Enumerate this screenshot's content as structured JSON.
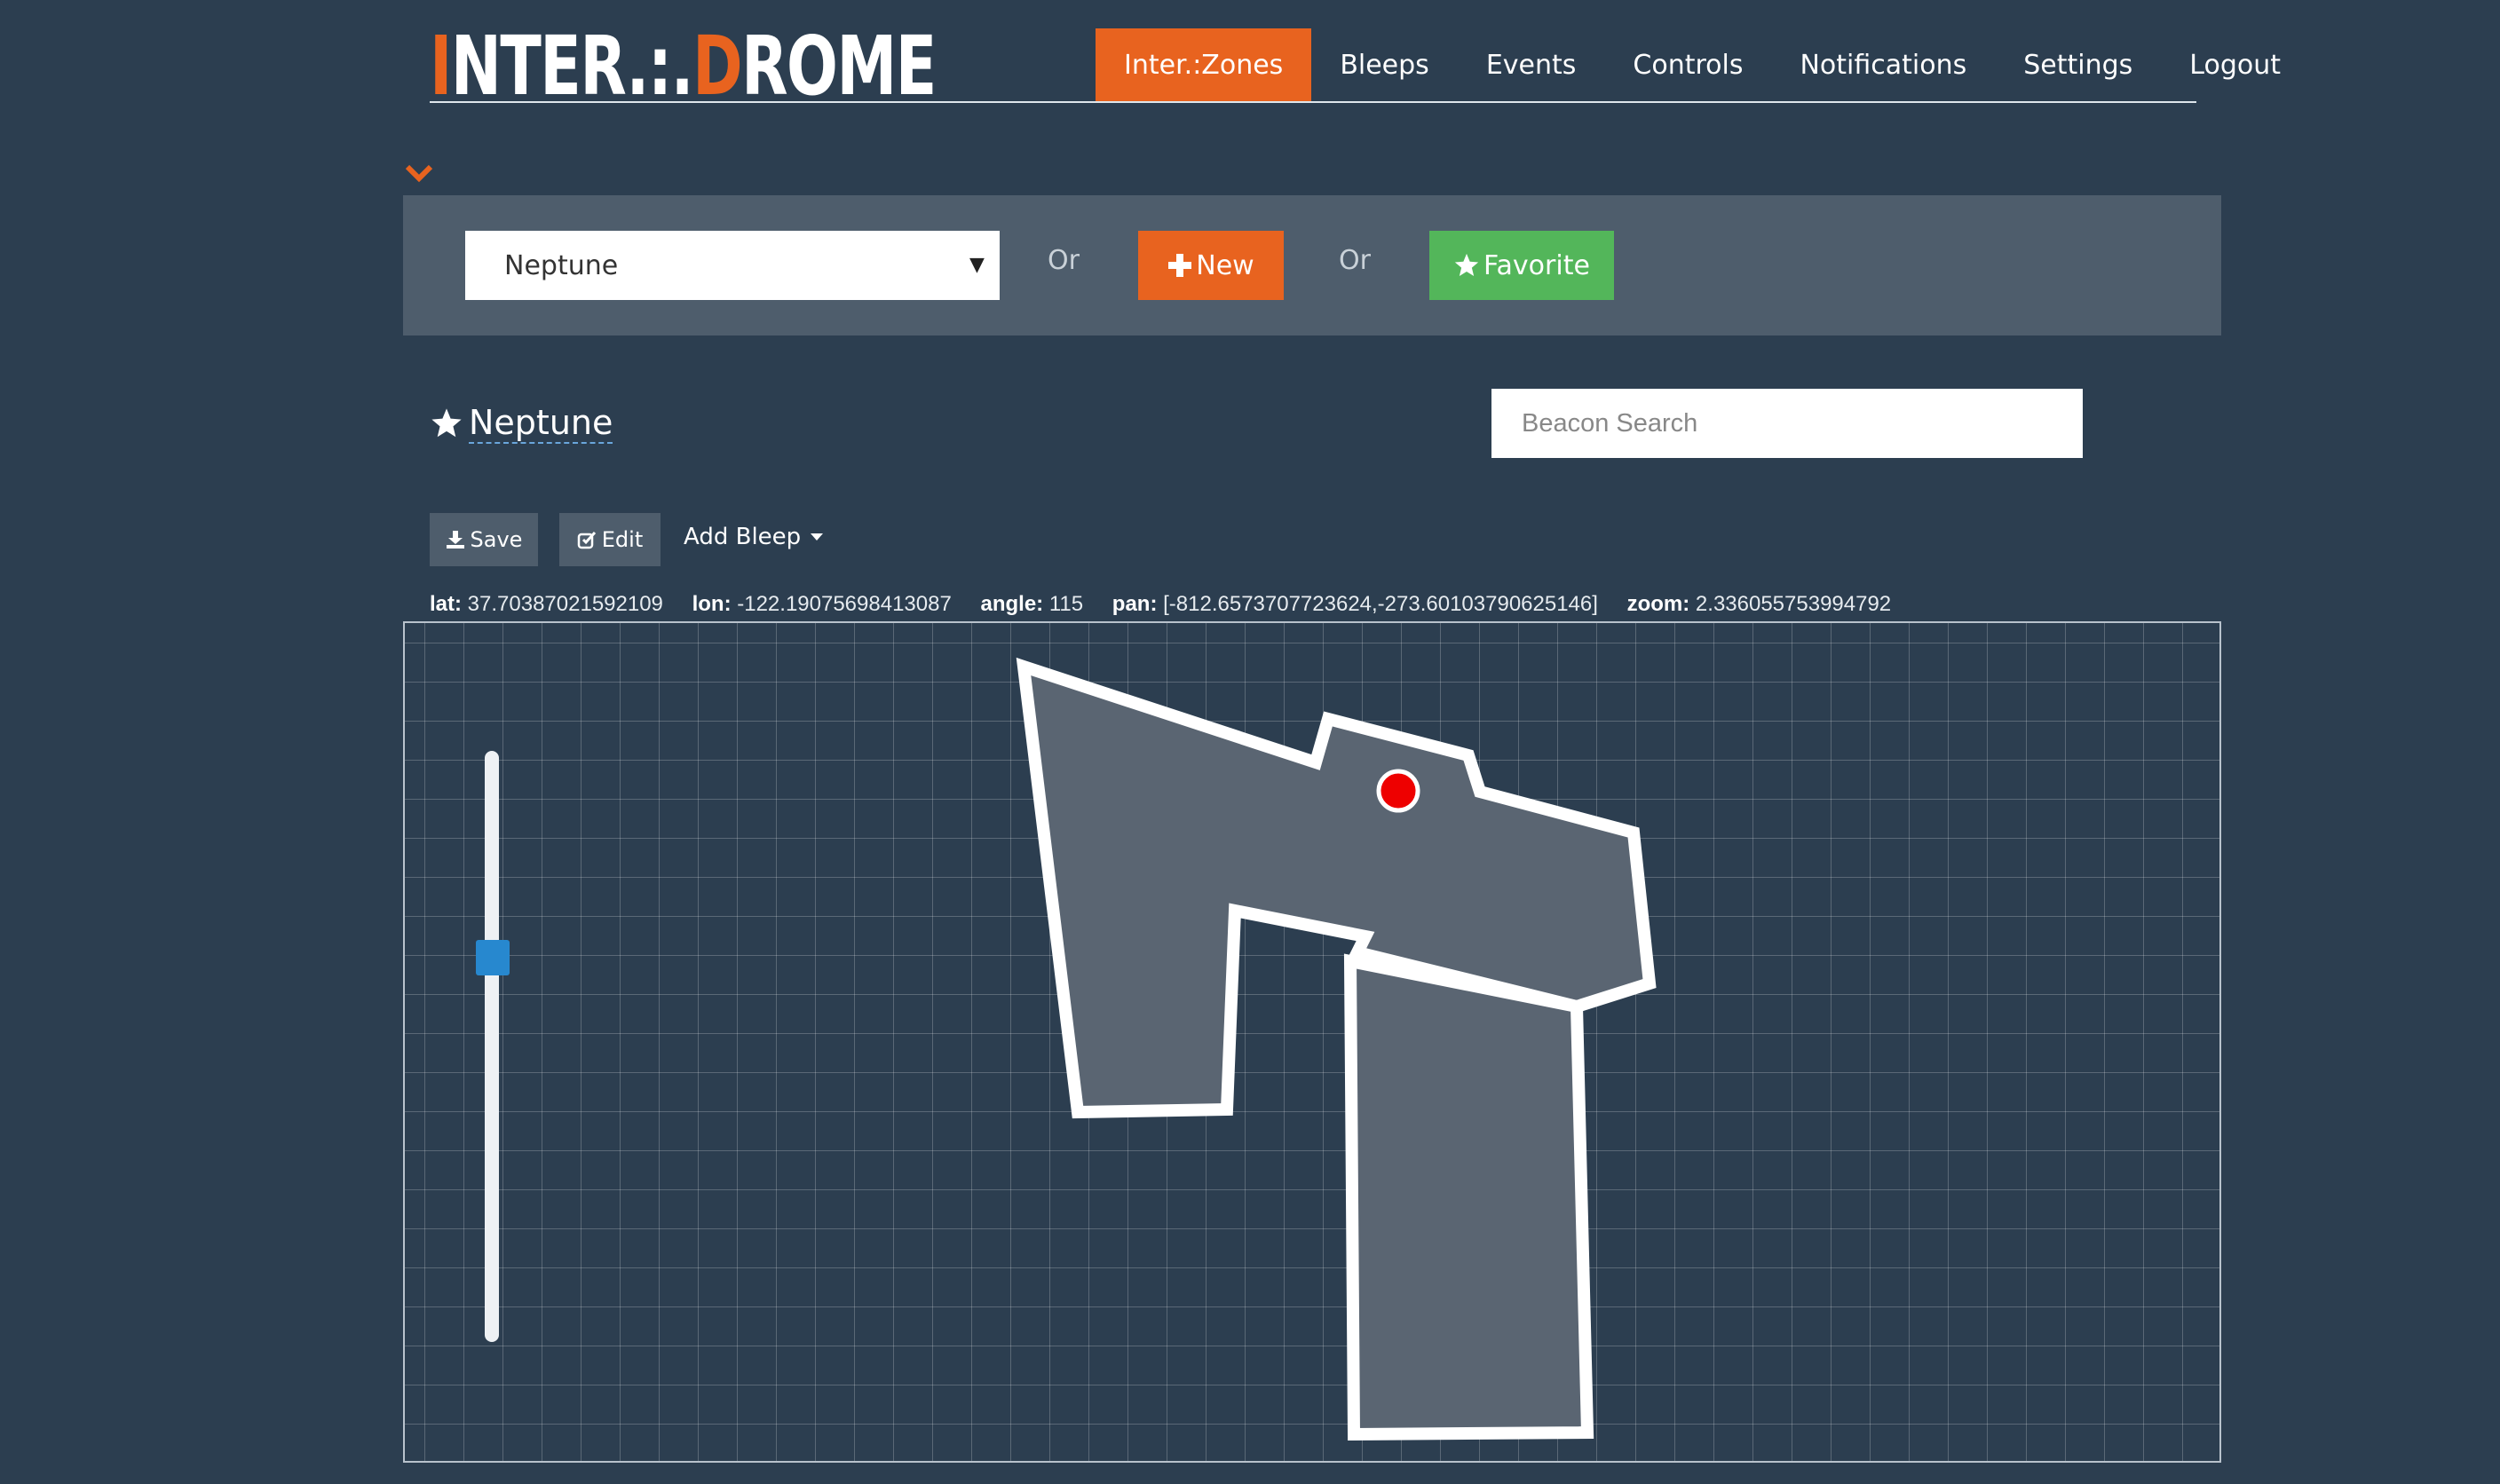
{
  "header": {
    "logo_part1": "I",
    "logo_part2": "NTER",
    "logo_part3": ".:",
    "logo_part4": ".",
    "logo_part5": "D",
    "logo_part6": "ROME",
    "nav": [
      {
        "label": "Inter.:Zones",
        "active": true
      },
      {
        "label": "Bleeps"
      },
      {
        "label": "Events"
      },
      {
        "label": "Controls"
      },
      {
        "label": "Notifications"
      },
      {
        "label": "Settings"
      },
      {
        "label": "Logout"
      }
    ]
  },
  "selector": {
    "selected_zone": "Neptune",
    "or_text": "Or",
    "new_label": "New",
    "favorite_label": "Favorite"
  },
  "zone": {
    "title": "Neptune",
    "beacon_search_placeholder": "Beacon Search"
  },
  "toolbar": {
    "save_label": "Save",
    "edit_label": "Edit",
    "add_bleep_label": "Add Bleep"
  },
  "readout": {
    "lat_label": "lat:",
    "lat": "37.70387021592109",
    "lon_label": "lon:",
    "lon": "-122.19075698413087",
    "angle_label": "angle:",
    "angle": "115",
    "pan_label": "pan:",
    "pan": "[-812.6573707723624,-273.60103790625146]",
    "zoom_label": "zoom:",
    "zoom": "2.336055753994792"
  },
  "map": {
    "zone_fill": "#5a6572",
    "zone_stroke": "#ffffff",
    "beacon_color": "#ee0000",
    "zoom_slider_level": 0.34
  },
  "colors": {
    "background": "#2c3e50",
    "accent": "#e8631f",
    "success": "#53b65a",
    "panel": "#4e5d6c"
  },
  "icons": {
    "chevron": "chevron-down-icon",
    "plus": "plus-icon",
    "star": "star-icon",
    "save": "download-icon",
    "edit": "edit-icon",
    "caret": "caret-down-icon"
  }
}
